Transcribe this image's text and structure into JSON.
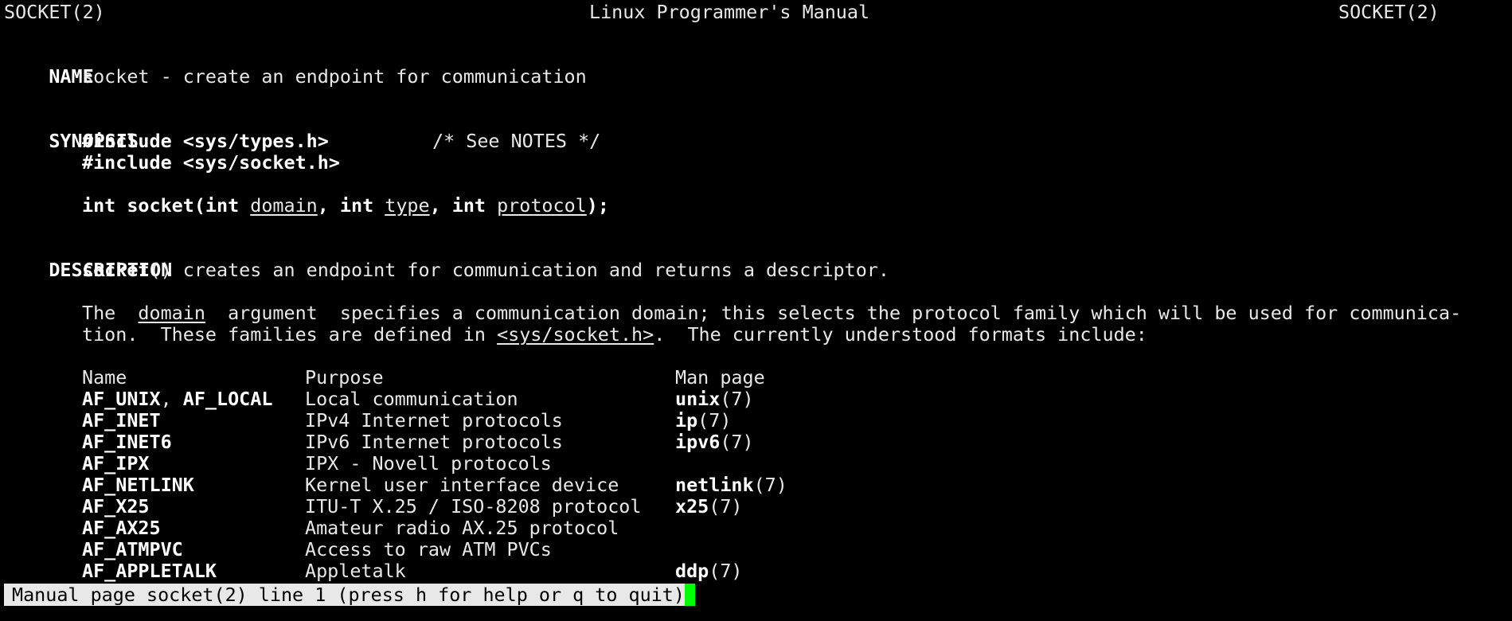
{
  "header": {
    "left": "SOCKET(2)",
    "center": "Linux Programmer's Manual",
    "right": "SOCKET(2)"
  },
  "name_section": {
    "heading": "NAME",
    "text": "socket - create an endpoint for communication"
  },
  "synopsis": {
    "heading": "SYNOPSIS",
    "include1": "#include <sys/types.h>",
    "include1_comment": "/* See NOTES */",
    "include2": "#include <sys/socket.h>",
    "sig": {
      "p1": "int socket(int ",
      "a1": "domain",
      "p2": ", int ",
      "a2": "type",
      "p3": ", int ",
      "a3": "protocol",
      "p4": ");"
    }
  },
  "description": {
    "heading": "DESCRIPTION",
    "line1_bold": "socket",
    "line1_rest": "() creates an endpoint for communication and returns a descriptor.",
    "p2_l1_a": "The  ",
    "p2_l1_u": "domain",
    "p2_l1_b": "  argument  specifies a communication domain; this selects the protocol family which will be used for communica-",
    "p2_l2_a": "tion.  These families are defined in ",
    "p2_l2_u": "<sys/socket.h>",
    "p2_l2_b": ".  The currently understood formats include:"
  },
  "families_table": {
    "headers": {
      "name": "Name",
      "purpose": "Purpose",
      "manpage": "Man page"
    },
    "rows": [
      {
        "name_a": "AF_UNIX",
        "sep": ", ",
        "name_b": "AF_LOCAL",
        "purpose": "Local communication",
        "man": "unix",
        "sec": "(7)"
      },
      {
        "name_a": "AF_INET",
        "sep": "",
        "name_b": "",
        "purpose": "IPv4 Internet protocols",
        "man": "ip",
        "sec": "(7)"
      },
      {
        "name_a": "AF_INET6",
        "sep": "",
        "name_b": "",
        "purpose": "IPv6 Internet protocols",
        "man": "ipv6",
        "sec": "(7)"
      },
      {
        "name_a": "AF_IPX",
        "sep": "",
        "name_b": "",
        "purpose": "IPX - Novell protocols",
        "man": "",
        "sec": ""
      },
      {
        "name_a": "AF_NETLINK",
        "sep": "",
        "name_b": "",
        "purpose": "Kernel user interface device",
        "man": "netlink",
        "sec": "(7)"
      },
      {
        "name_a": "AF_X25",
        "sep": "",
        "name_b": "",
        "purpose": "ITU-T X.25 / ISO-8208 protocol",
        "man": "x25",
        "sec": "(7)"
      },
      {
        "name_a": "AF_AX25",
        "sep": "",
        "name_b": "",
        "purpose": "Amateur radio AX.25 protocol",
        "man": "",
        "sec": ""
      },
      {
        "name_a": "AF_ATMPVC",
        "sep": "",
        "name_b": "",
        "purpose": "Access to raw ATM PVCs",
        "man": "",
        "sec": ""
      },
      {
        "name_a": "AF_APPLETALK",
        "sep": "",
        "name_b": "",
        "purpose": "Appletalk",
        "man": "ddp",
        "sec": "(7)"
      }
    ]
  },
  "status_bar": {
    "text": "Manual page socket(2) line 1 (press h for help or q to quit)"
  },
  "colors": {
    "background": "#000000",
    "text": "#e8e8e8",
    "bold_text": "#ffffff",
    "status_bg": "#e8e8e8",
    "cursor": "#00ff00"
  }
}
